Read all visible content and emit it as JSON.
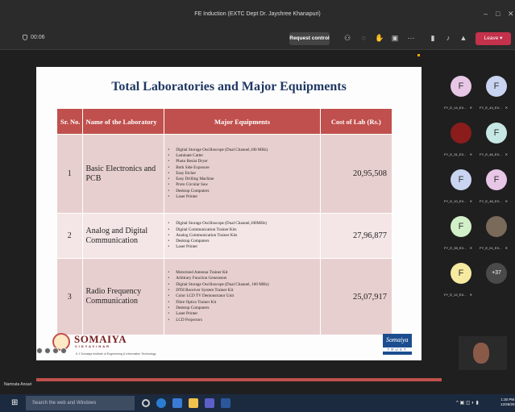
{
  "window": {
    "title": "FE Induction (EXTC Dept Dr. Jayshree Khanapuri)"
  },
  "toolbar": {
    "timer": "00:06",
    "request_control_label": "Request control",
    "leave_label": "Leave"
  },
  "slide": {
    "title": "Total Laboratories and Major Equipments",
    "columns": [
      "Sr. No.",
      "Name of the Laboratory",
      "Major Equipments",
      "Cost of Lab (Rs.)"
    ],
    "rows": [
      {
        "sr": "1",
        "lab": "Basic Electronics and PCB",
        "equipments": [
          "Digital Storage Oscilloscope (Dual Channel,100 MHz)",
          "Laminate Cutter",
          "Photo Resist Dryer",
          "Both Side Exposure",
          "Easy Etcher",
          "Easy Drilling Machine",
          "Proto Circular Saw",
          "Desktop Computers",
          "Laser Printer"
        ],
        "cost": "20,95,508"
      },
      {
        "sr": "2",
        "lab": "Analog and Digital Communication",
        "equipments": [
          "Digital Storage Oscilloscope (Dual Channel,100MHz)",
          "Digital Communication Trainer Kits",
          "Analog Communication Trainer Kits",
          "Desktop Computers",
          "Laser Printer"
        ],
        "cost": "27,96,877"
      },
      {
        "sr": "3",
        "lab": "Radio Frequency Communication",
        "equipments": [
          "Motorized Antenna Trainer Kit",
          "Arbitrary Function Generators",
          "Digital Storage Oscilloscope (Dual Channel, 100 MHz)",
          "DTH Receiver System Trainer Kit",
          "Color LCD TV Demonstrator Unit",
          "Fibre Optics Trainer Kit",
          "Desktop Computers",
          "Laser Printer",
          "LCD Projectors"
        ],
        "cost": "25,07,917"
      }
    ],
    "footer": {
      "university": "SOMAIYA",
      "subtitle": "VIDYAVIHAR",
      "institute": "K J Somaiya Institute of Engineering & Information Technology",
      "trust_script": "Somaiya",
      "trust_label": "TRUST"
    }
  },
  "presenter_name": "Namrata Ansari",
  "participants": [
    {
      "initial": "F",
      "name": "FY_E_14_EX...",
      "color": "#e8c6e6"
    },
    {
      "initial": "F",
      "name": "FY_E_44_EX...",
      "color": "#c8d4f0"
    },
    {
      "initial": "",
      "name": "FY_E_31_EX...",
      "color": "#8a1c1c"
    },
    {
      "initial": "F",
      "name": "FY_E_46_EX...",
      "color": "#c6e8e4"
    },
    {
      "initial": "F",
      "name": "FY_E_10_EX...",
      "color": "#c8d4f0"
    },
    {
      "initial": "F",
      "name": "FY_E_48_EX...",
      "color": "#e8c6e6"
    },
    {
      "initial": "F",
      "name": "FY_E_35_EX...",
      "color": "#d2f0c8"
    },
    {
      "initial": "",
      "name": "FY_E_01_EX...",
      "color": "#7a6a5a"
    },
    {
      "initial": "F",
      "name": "FY_E_12_EX...",
      "color": "#f5eaa0"
    },
    {
      "initial": "+37",
      "name": "",
      "color": "#4a4a4a"
    }
  ],
  "taskbar": {
    "search_placeholder": "Search the web and Windows",
    "time": "1:30 PM",
    "date": "12/28/20"
  }
}
